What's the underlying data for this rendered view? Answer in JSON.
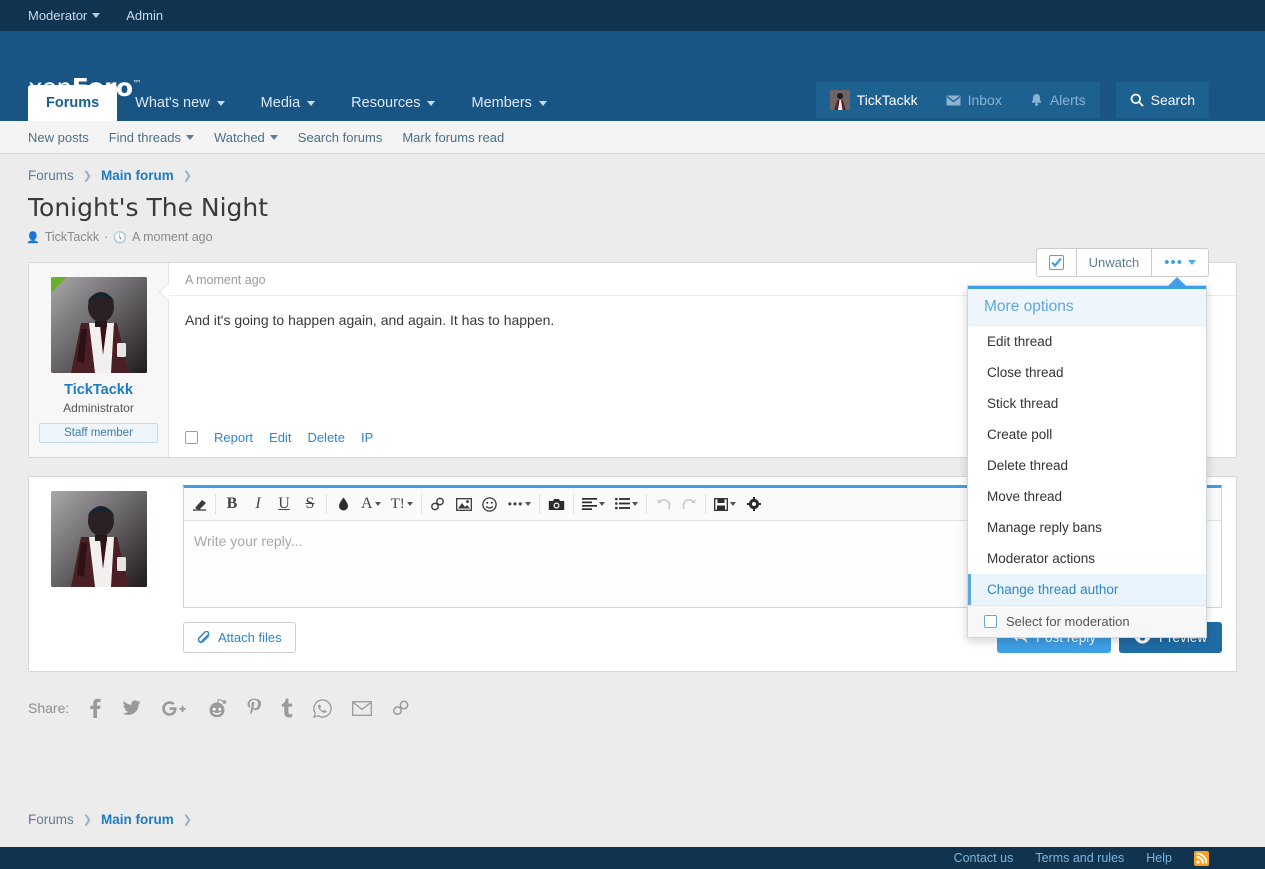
{
  "modbar": {
    "items": [
      {
        "label": "Moderator",
        "has_caret": true
      },
      {
        "label": "Admin",
        "has_caret": false
      }
    ]
  },
  "header": {
    "logo_prefix": "xen",
    "logo_suffix": "Foro",
    "logo_tm": "™",
    "tabs": [
      {
        "label": "Forums",
        "active": true,
        "caret": false
      },
      {
        "label": "What's new",
        "active": false,
        "caret": true
      },
      {
        "label": "Media",
        "active": false,
        "caret": true
      },
      {
        "label": "Resources",
        "active": false,
        "caret": true
      },
      {
        "label": "Members",
        "active": false,
        "caret": true
      }
    ],
    "user": {
      "name": "TickTackk"
    },
    "inbox": {
      "label": "Inbox",
      "icon": "envelope-icon"
    },
    "alerts": {
      "label": "Alerts",
      "icon": "bell-icon"
    },
    "search": {
      "label": "Search",
      "icon": "magnifier-icon"
    }
  },
  "subnav": {
    "items": [
      {
        "label": "New posts",
        "caret": false
      },
      {
        "label": "Find threads",
        "caret": true
      },
      {
        "label": "Watched",
        "caret": true
      },
      {
        "label": "Search forums",
        "caret": false
      },
      {
        "label": "Mark forums read",
        "caret": false
      }
    ]
  },
  "breadcrumb": {
    "items": [
      {
        "label": "Forums",
        "bold": false
      },
      {
        "label": "Main forum",
        "bold": true
      }
    ]
  },
  "thread": {
    "title": "Tonight's The Night",
    "author": "TickTackk",
    "separator": "·",
    "time": "A moment ago",
    "author_icon": "user-icon",
    "time_icon": "clock-icon"
  },
  "actions": {
    "watch_icon": "checkbox-checked-icon",
    "unwatch_label": "Unwatch",
    "more_label": "•••"
  },
  "more_menu": {
    "title": "More options",
    "items": [
      {
        "label": "Edit thread",
        "highlighted": false
      },
      {
        "label": "Close thread",
        "highlighted": false
      },
      {
        "label": "Stick thread",
        "highlighted": false
      },
      {
        "label": "Create poll",
        "highlighted": false
      },
      {
        "label": "Delete thread",
        "highlighted": false
      },
      {
        "label": "Move thread",
        "highlighted": false
      },
      {
        "label": "Manage reply bans",
        "highlighted": false
      },
      {
        "label": "Moderator actions",
        "highlighted": false
      },
      {
        "label": "Change thread author",
        "highlighted": true
      }
    ],
    "checkbox_label": "Select for moderation",
    "accent_color": "#3e9fe5"
  },
  "post": {
    "author": "TickTackk",
    "user_title": "Administrator",
    "banner": "Staff member",
    "time": "A moment ago",
    "body": "And it's going to happen again, and again. It has to happen.",
    "footer_links": [
      "Report",
      "Edit",
      "Delete",
      "IP"
    ]
  },
  "editor": {
    "placeholder": "Write your reply...",
    "toolbar": [
      {
        "name": "remove-formatting-icon",
        "glyph": "▱",
        "caret": false,
        "dim": false,
        "sep_after": true
      },
      {
        "name": "bold-icon",
        "glyph": "B",
        "caret": false,
        "dim": false,
        "sep_after": false
      },
      {
        "name": "italic-icon",
        "glyph": "I",
        "caret": false,
        "dim": false,
        "sep_after": false
      },
      {
        "name": "underline-icon",
        "glyph": "U",
        "caret": false,
        "dim": false,
        "sep_after": false
      },
      {
        "name": "strikethrough-icon",
        "glyph": "S",
        "caret": false,
        "dim": false,
        "sep_after": true
      },
      {
        "name": "text-color-icon",
        "glyph": "●",
        "caret": false,
        "dim": false,
        "sep_after": false
      },
      {
        "name": "font-family-icon",
        "glyph": "A",
        "caret": true,
        "dim": false,
        "sep_after": false
      },
      {
        "name": "font-size-icon",
        "glyph": "T!",
        "caret": true,
        "dim": false,
        "sep_after": true
      },
      {
        "name": "link-icon",
        "glyph": "⚭",
        "caret": false,
        "dim": false,
        "sep_after": false
      },
      {
        "name": "image-icon",
        "glyph": "▣",
        "caret": false,
        "dim": false,
        "sep_after": false
      },
      {
        "name": "smilie-icon",
        "glyph": "☺",
        "caret": false,
        "dim": false,
        "sep_after": false
      },
      {
        "name": "more-tools-icon",
        "glyph": "•••",
        "caret": true,
        "dim": false,
        "sep_after": true
      },
      {
        "name": "camera-icon",
        "glyph": "■",
        "caret": false,
        "dim": false,
        "sep_after": true
      },
      {
        "name": "align-icon",
        "glyph": "☰",
        "caret": true,
        "dim": false,
        "sep_after": false
      },
      {
        "name": "list-icon",
        "glyph": "☰",
        "caret": true,
        "dim": false,
        "sep_after": true
      },
      {
        "name": "undo-icon",
        "glyph": "↶",
        "caret": false,
        "dim": true,
        "sep_after": false
      },
      {
        "name": "redo-icon",
        "glyph": "↷",
        "caret": false,
        "dim": true,
        "sep_after": true
      },
      {
        "name": "draft-icon",
        "glyph": "▤",
        "caret": true,
        "dim": false,
        "sep_after": false
      },
      {
        "name": "settings-gear-icon",
        "glyph": "⚙",
        "caret": false,
        "dim": false,
        "sep_after": false
      }
    ],
    "attach_label": "Attach files",
    "post_reply_label": "Post reply",
    "preview_label": "Preview",
    "post_reply_color": "#3e9fe5",
    "preview_color": "#1f6ca5"
  },
  "share": {
    "label": "Share:",
    "networks": [
      "facebook-icon",
      "twitter-icon",
      "google-plus-icon",
      "reddit-icon",
      "pinterest-icon",
      "tumblr-icon",
      "whatsapp-icon",
      "email-icon",
      "link-icon"
    ]
  },
  "footer": {
    "links": [
      "Contact us",
      "Terms and rules",
      "Help"
    ],
    "rss_icon": "rss-icon"
  }
}
